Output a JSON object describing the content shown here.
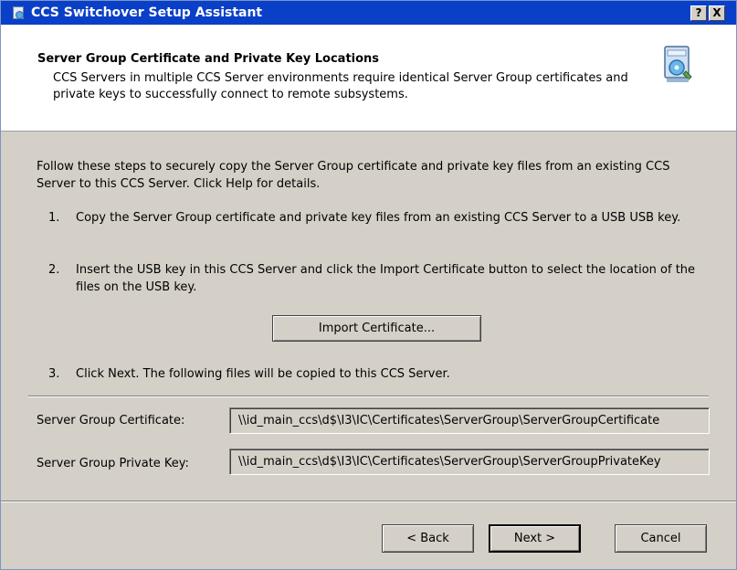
{
  "window": {
    "title": "CCS Switchover Setup Assistant",
    "help_label": "?",
    "close_label": "X"
  },
  "header": {
    "title": "Server Group Certificate and Private Key Locations",
    "subtitle": "CCS Servers in multiple CCS Server environments require identical Server Group certificates and private keys to successfully connect to remote subsystems."
  },
  "main": {
    "intro": "Follow these steps to securely copy the Server Group certificate and private key files from an existing CCS Server to this CCS Server. Click Help for details.",
    "steps": [
      {
        "num": "1.",
        "text": "Copy the Server Group certificate and private key files from an existing CCS Server to a USB USB key."
      },
      {
        "num": "2.",
        "text": "Insert the USB key in this CCS Server and click the Import Certificate button to select the location of the files on the USB key."
      },
      {
        "num": "3.",
        "text": "Click Next. The following files will be copied to this CCS Server."
      }
    ],
    "import_button": "Import Certificate...",
    "fields": [
      {
        "label": "Server Group Certificate:",
        "value": "\\\\id_main_ccs\\d$\\I3\\IC\\Certificates\\ServerGroup\\ServerGroupCertificate"
      },
      {
        "label": "Server Group Private Key:",
        "value": "\\\\id_main_ccs\\d$\\I3\\IC\\Certificates\\ServerGroup\\ServerGroupPrivateKey"
      }
    ]
  },
  "footer": {
    "back_label": "< Back",
    "next_label": "Next >",
    "cancel_label": "Cancel"
  },
  "icons": {
    "app": "installer-icon",
    "wizard": "installer-box-icon"
  }
}
